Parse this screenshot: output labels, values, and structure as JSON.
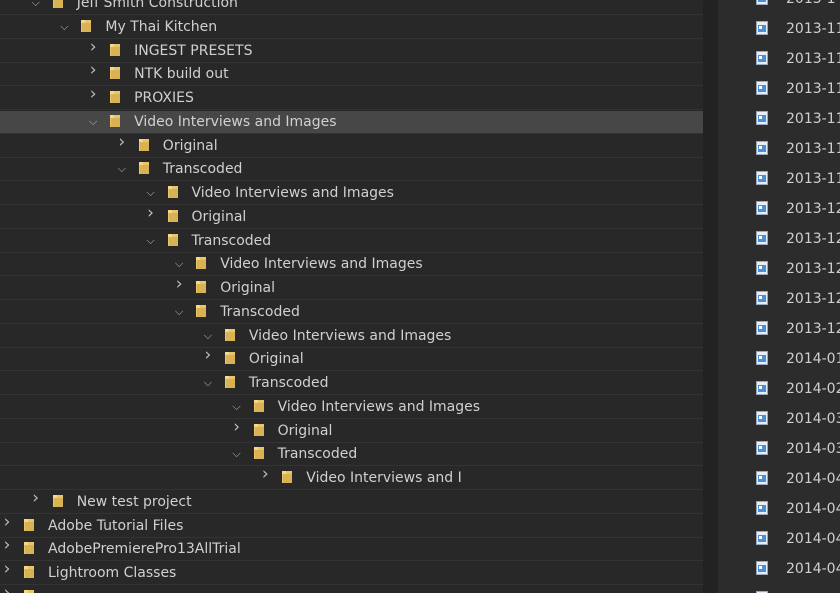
{
  "folder_tree": {
    "rows": [
      {
        "label": "Jeff Smith Construction",
        "toggle": "expanded",
        "selected": false
      },
      {
        "label": "My Thai Kitchen",
        "toggle": "expanded",
        "selected": false
      },
      {
        "label": "INGEST PRESETS",
        "toggle": "collapsed",
        "selected": false
      },
      {
        "label": "NTK build out",
        "toggle": "collapsed",
        "selected": false
      },
      {
        "label": "PROXIES",
        "toggle": "collapsed",
        "selected": false
      },
      {
        "label": "Video Interviews and Images",
        "toggle": "expanded",
        "selected": true
      },
      {
        "label": "Original",
        "toggle": "collapsed",
        "selected": false
      },
      {
        "label": "Transcoded",
        "toggle": "expanded",
        "selected": false
      },
      {
        "label": "Video Interviews and Images",
        "toggle": "expanded",
        "selected": false
      },
      {
        "label": "Original",
        "toggle": "collapsed",
        "selected": false
      },
      {
        "label": "Transcoded",
        "toggle": "expanded",
        "selected": false
      },
      {
        "label": "Video Interviews and Images",
        "toggle": "expanded",
        "selected": false
      },
      {
        "label": "Original",
        "toggle": "collapsed",
        "selected": false
      },
      {
        "label": "Transcoded",
        "toggle": "expanded",
        "selected": false
      },
      {
        "label": "Video Interviews and Images",
        "toggle": "expanded",
        "selected": false
      },
      {
        "label": "Original",
        "toggle": "collapsed",
        "selected": false
      },
      {
        "label": "Transcoded",
        "toggle": "expanded",
        "selected": false
      },
      {
        "label": "Video Interviews and Images",
        "toggle": "expanded",
        "selected": false
      },
      {
        "label": "Original",
        "toggle": "collapsed",
        "selected": false
      },
      {
        "label": "Transcoded",
        "toggle": "expanded",
        "selected": false
      },
      {
        "label": "Video Interviews and I",
        "toggle": "collapsed",
        "selected": false
      },
      {
        "label": "New test project",
        "toggle": "collapsed",
        "selected": false
      },
      {
        "label": "Adobe Tutorial Files",
        "toggle": "collapsed",
        "selected": false
      },
      {
        "label": "AdobePremierePro13AllTrial",
        "toggle": "collapsed",
        "selected": false
      },
      {
        "label": "Lightroom Classes",
        "toggle": "collapsed",
        "selected": false
      },
      {
        "label": "",
        "toggle": "collapsed",
        "selected": false
      }
    ]
  },
  "file_list": {
    "items": [
      {
        "label": "2013-1"
      },
      {
        "label": "2013-11"
      },
      {
        "label": "2013-11"
      },
      {
        "label": "2013-11"
      },
      {
        "label": "2013-11"
      },
      {
        "label": "2013-11"
      },
      {
        "label": "2013-11"
      },
      {
        "label": "2013-12"
      },
      {
        "label": "2013-12"
      },
      {
        "label": "2013-12"
      },
      {
        "label": "2013-12"
      },
      {
        "label": "2013-12"
      },
      {
        "label": "2014-01"
      },
      {
        "label": "2014-02"
      },
      {
        "label": "2014-03"
      },
      {
        "label": "2014-03"
      },
      {
        "label": "2014-04"
      },
      {
        "label": "2014-04"
      },
      {
        "label": "2014-04"
      },
      {
        "label": "2014-04"
      },
      {
        "label": ""
      }
    ]
  },
  "colors": {
    "folder_fill": "#e8c46a",
    "folder_tab": "#f3d98c",
    "file_icon_blue": "#4a90d9",
    "selected_row": "#474747"
  },
  "icons": {
    "folder": "folder-icon",
    "file": "image-file-icon",
    "expanded": "chevron-down-icon",
    "collapsed": "chevron-right-icon"
  }
}
